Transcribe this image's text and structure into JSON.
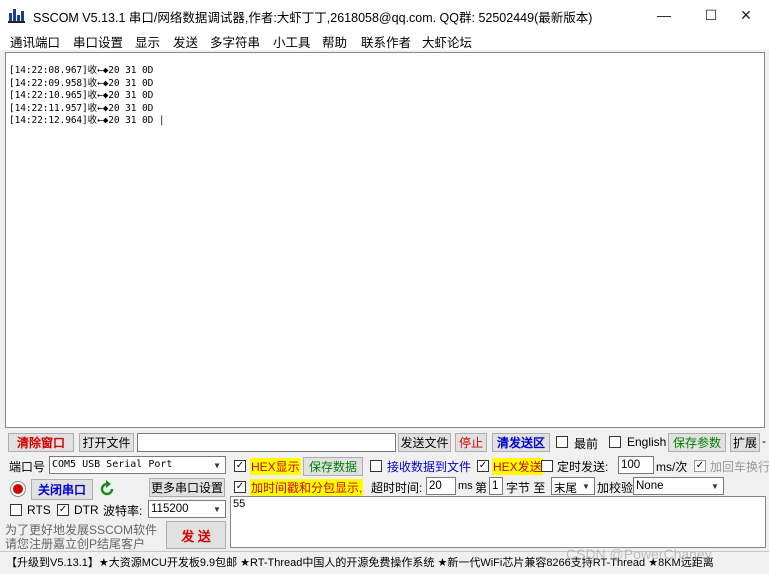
{
  "window": {
    "title": "SSCOM V5.13.1 串口/网络数据调试器,作者:大虾丁丁,2618058@qq.com. QQ群: 52502449(最新版本)",
    "minimize_glyph": "—",
    "maximize_glyph": "☐",
    "close_glyph": "✕"
  },
  "menu": [
    "通讯端口",
    "串口设置",
    "显示",
    "发送",
    "多字符串",
    "小工具",
    "帮助",
    "联系作者",
    "大虾论坛"
  ],
  "receive": {
    "lines": [
      "[14:22:08.967]收←◆20 31 0D",
      "[14:22:09.958]收←◆20 31 0D",
      "[14:22:10.965]收←◆20 31 0D",
      "[14:22:11.957]收←◆20 31 0D",
      "[14:22:12.964]收←◆20 31 0D |"
    ]
  },
  "toolbar1": {
    "clear_window": "清除窗口",
    "open_file": "打开文件",
    "file_path": "",
    "send_file": "发送文件",
    "stop": "停止",
    "clear_send": "清发送区",
    "topmost": "最前",
    "english": "English",
    "save_params": "保存参数",
    "expand": "扩展",
    "expand_dash": "-"
  },
  "port": {
    "port_label": "端口号",
    "port_value": "COM5 USB Serial Port",
    "close_port": "关闭串口",
    "more_settings": "更多串口设置",
    "rts": "RTS",
    "dtr": "DTR",
    "baud_label": "波特率:",
    "baud_value": "115200"
  },
  "options": {
    "hex_display": "HEX显示",
    "save_data": "保存数据",
    "recv_to_file": "接收数据到文件",
    "hex_send": "HEX发送",
    "timed_send": "定时发送:",
    "timed_value": "100",
    "timed_unit": "ms/次",
    "add_crlf": "加回车换行",
    "timestamp": "加时间戳和分包显示,",
    "timeout_label": "超时时间:",
    "timeout_value": "20",
    "ms": "ms",
    "nth": "第",
    "byte_value": "1",
    "byte_label": "字节 至",
    "end_value": "末尾",
    "checksum_label": "加校验",
    "checksum_value": "None"
  },
  "send": {
    "text": "55",
    "button": "发 送",
    "promo_line1": "为了更好地发展SSCOM软件",
    "promo_line2": "请您注册嘉立创P结尾客户"
  },
  "status": {
    "text": "【升级到V5.13.1】★大资源MCU开发板9.9包邮 ★RT-Thread中国人的开源免费操作系统 ★新一代WiFi芯片兼容8266支持RT-Thread ★8KM远距离"
  },
  "watermark": "CSDN @PowerChaney",
  "colors": {
    "accent_red": "#d40000",
    "accent_blue": "#0000d0",
    "accent_green": "#008000",
    "highlight": "#ffff00"
  }
}
